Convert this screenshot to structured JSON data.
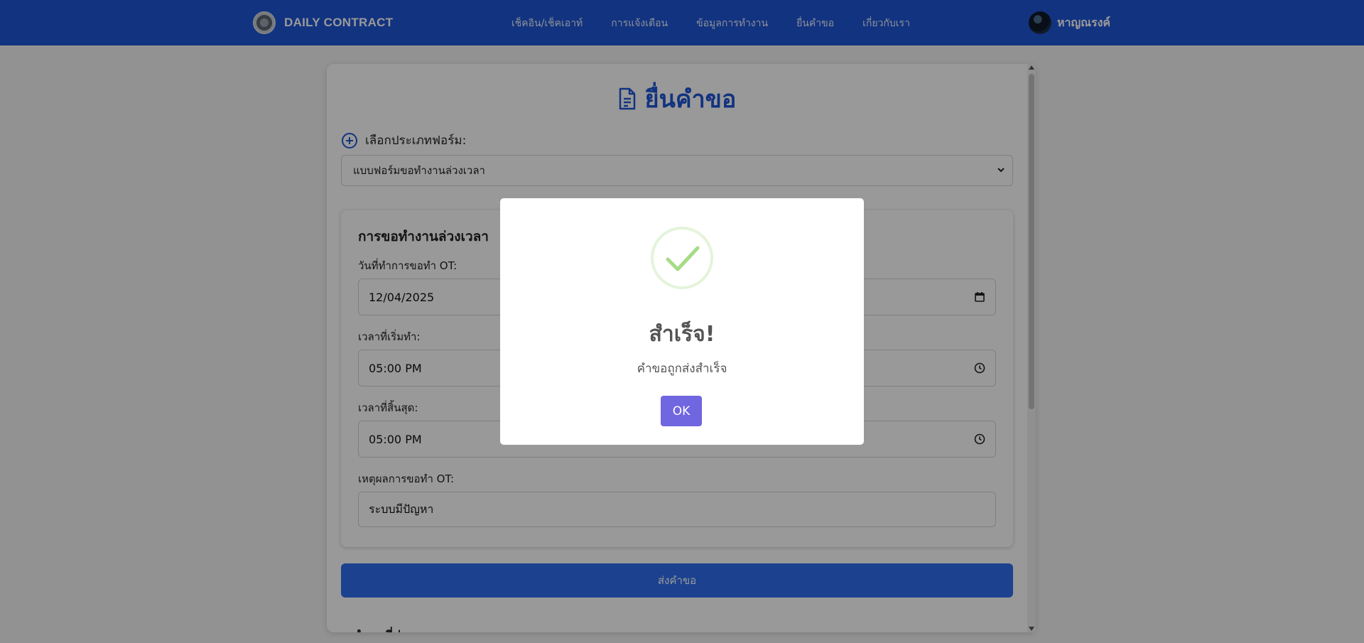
{
  "brand": {
    "name": "DAILY CONTRACT"
  },
  "nav": {
    "links": [
      "เช็คอิน/เช็คเอาท์",
      "การแจ้งเตือน",
      "ข้อมูลการทำงาน",
      "ยื่นคำขอ",
      "เกี่ยวกับเรา"
    ]
  },
  "user": {
    "name": "หาญณรงค์"
  },
  "page": {
    "title": "ยื่นคำขอ",
    "select_label": "เลือกประเภทฟอร์ม:",
    "selected_form": "แบบฟอร์มขอทำงานล่วงเวลา"
  },
  "ot_form": {
    "title": "การขอทำงานล่วงเวลา",
    "date_label": "วันที่ทำการขอทำ OT:",
    "date_value": "12/04/2025",
    "start_label": "เวลาที่เริ่มทำ:",
    "start_value": "05:00 PM",
    "end_label": "เวลาที่สิ้นสุด:",
    "end_value": "05:00 PM",
    "reason_label": "เหตุผลการขอทำ OT:",
    "reason_value": "ระบบมีปัญหา",
    "submit_label": "ส่งคำขอ"
  },
  "next_section": {
    "title": "คำขอที่ส่ง"
  },
  "modal": {
    "title": "สำเร็จ!",
    "message": "คำขอถูกส่งสำเร็จ",
    "ok_label": "OK"
  },
  "colors": {
    "navbar": "#1f55d6",
    "primary_button": "#2f6fef",
    "modal_ok": "#7066e0",
    "success_green": "#a5dc86"
  },
  "icons": {
    "brand": "logo-icon",
    "page_title": "document-icon",
    "select_label": "plus-circle-icon",
    "date_field": "calendar-icon",
    "time_fields": "clock-icon",
    "modal": "success-check-icon"
  }
}
